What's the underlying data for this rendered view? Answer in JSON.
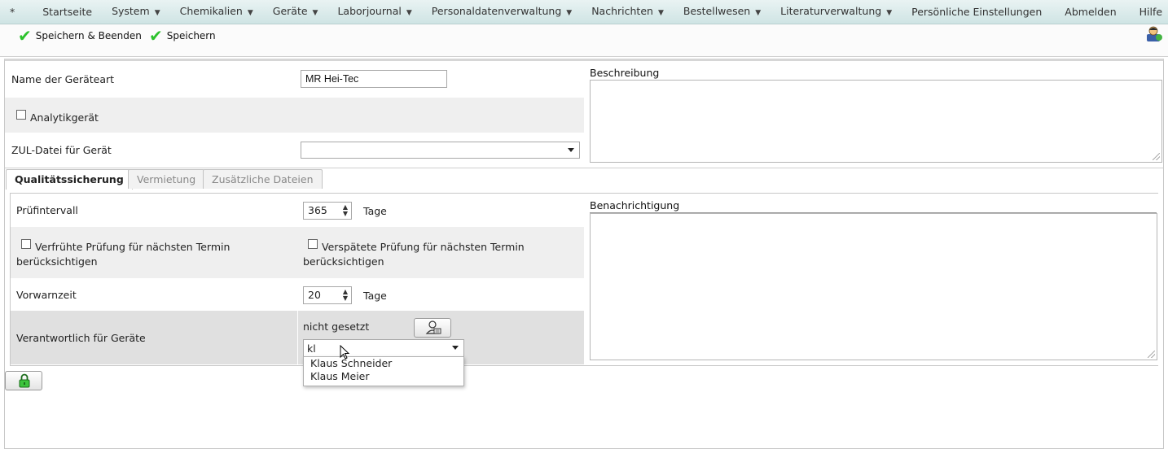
{
  "menu": {
    "items": [
      {
        "label": "*",
        "caret": false
      },
      {
        "label": "Startseite",
        "caret": false
      },
      {
        "label": "System",
        "caret": true
      },
      {
        "label": "Chemikalien",
        "caret": true
      },
      {
        "label": "Geräte",
        "caret": true
      },
      {
        "label": "Laborjournal",
        "caret": true
      },
      {
        "label": "Personaldatenverwaltung",
        "caret": true
      },
      {
        "label": "Nachrichten",
        "caret": true
      },
      {
        "label": "Bestellwesen",
        "caret": true
      },
      {
        "label": "Literaturverwaltung",
        "caret": true
      },
      {
        "label": "Persönliche Einstellungen",
        "caret": false
      },
      {
        "label": "Abmelden",
        "caret": false
      },
      {
        "label": "Hilfe",
        "caret": false
      }
    ],
    "caret_glyph": "▼"
  },
  "toolbar": {
    "save_close_label": "Speichern & Beenden",
    "save_label": "Speichern",
    "check_glyph": "✔"
  },
  "form": {
    "name_label": "Name der Geräteart",
    "name_value": "MR Hei-Tec",
    "analytik_label": "Analytikgerät",
    "analytik_checked": false,
    "zul_label": "ZUL-Datei für Gerät",
    "zul_value": "",
    "beschreibung_label": "Beschreibung"
  },
  "tabs": [
    {
      "label": "Qualitätssicherung",
      "active": true
    },
    {
      "label": "Vermietung",
      "active": false
    },
    {
      "label": "Zusätzliche Dateien",
      "active": false
    }
  ],
  "qs": {
    "pruefintervall_label": "Prüfintervall",
    "pruefintervall_value": "365",
    "pruefintervall_unit": "Tage",
    "verfrueht_line1": "Verfrühte Prüfung für nächsten Termin",
    "verfrueht_line2": "berücksichtigen",
    "verspaetet_line1": "Verspätete Prüfung für nächsten Termin",
    "verspaetet_line2": "berücksichtigen",
    "vorwarnzeit_label": "Vorwarnzeit",
    "vorwarnzeit_value": "20",
    "vorwarnzeit_unit": "Tage",
    "verantwortlich_label": "Verantwortlich für Geräte",
    "verantwortlich_value": "nicht gesetzt",
    "combo_value": "kl",
    "benachrichtigung_label": "Benachrichtigung",
    "options": [
      "Klaus Schneider",
      "Klaus Meier"
    ]
  },
  "colors": {
    "menu_bg": "#d7e9e9",
    "check_green": "#2cc22c",
    "band_grey": "#efefef",
    "band_dark": "#e0e0e0"
  }
}
